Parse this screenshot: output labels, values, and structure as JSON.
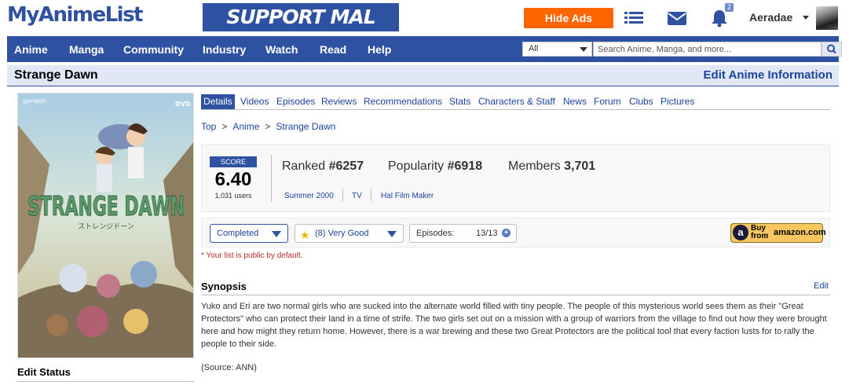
{
  "header": {
    "logo": "MyAnimeList",
    "support_banner": "SUPPORT MAL",
    "hide_ads": "Hide Ads",
    "notification_count": "2",
    "username": "Aeradae"
  },
  "nav": {
    "items": [
      "Anime",
      "Manga",
      "Community",
      "Industry",
      "Watch",
      "Read",
      "Help"
    ],
    "search_category": "All",
    "search_placeholder": "Search Anime, Manga, and more..."
  },
  "page": {
    "title": "Strange Dawn",
    "edit_info": "Edit Anime Information"
  },
  "cover": {
    "brand": "geneon",
    "format": "DVD",
    "title": "STRANGE DAWN",
    "subtitle_jp": "ストレンジドーン"
  },
  "tabs": [
    "Details",
    "Videos",
    "Episodes",
    "Reviews",
    "Recommendations",
    "Stats",
    "Characters & Staff",
    "News",
    "Forum",
    "Clubs",
    "Pictures"
  ],
  "breadcrumb": [
    "Top",
    "Anime",
    "Strange Dawn"
  ],
  "stats": {
    "score_label": "SCORE",
    "score": "6.40",
    "score_users": "1,031 users",
    "ranked_label": "Ranked",
    "ranked": "#6257",
    "popularity_label": "Popularity",
    "popularity": "#6918",
    "members_label": "Members",
    "members": "3,701",
    "season": "Summer 2000",
    "type": "TV",
    "studio": "Hal Film Maker"
  },
  "user_status": {
    "status": "Completed",
    "score": "(8) Very Good",
    "episodes_label": "Episodes:",
    "episodes": "13/13",
    "amazon_buy": "Buy from",
    "amazon_name": "amazon.com"
  },
  "left": {
    "edit_status": "Edit Status"
  },
  "note": "* Your list is public by default.",
  "synopsis": {
    "title": "Synopsis",
    "edit": "Edit",
    "text": "Yuko and Eri are two normal girls who are sucked into the alternate world filled with tiny people. The people of this mysterious world sees them as their \"Great Protectors\" who can protect their land in a time of strife. The two girls set out on a mission with a group of warriors from the village to find out how they were brought here and how might they return home. However, there is a war brewing and these two Great Protectors are the political tool that every faction lusts for to rally the people to their side.",
    "source": "(Source: ANN)"
  }
}
